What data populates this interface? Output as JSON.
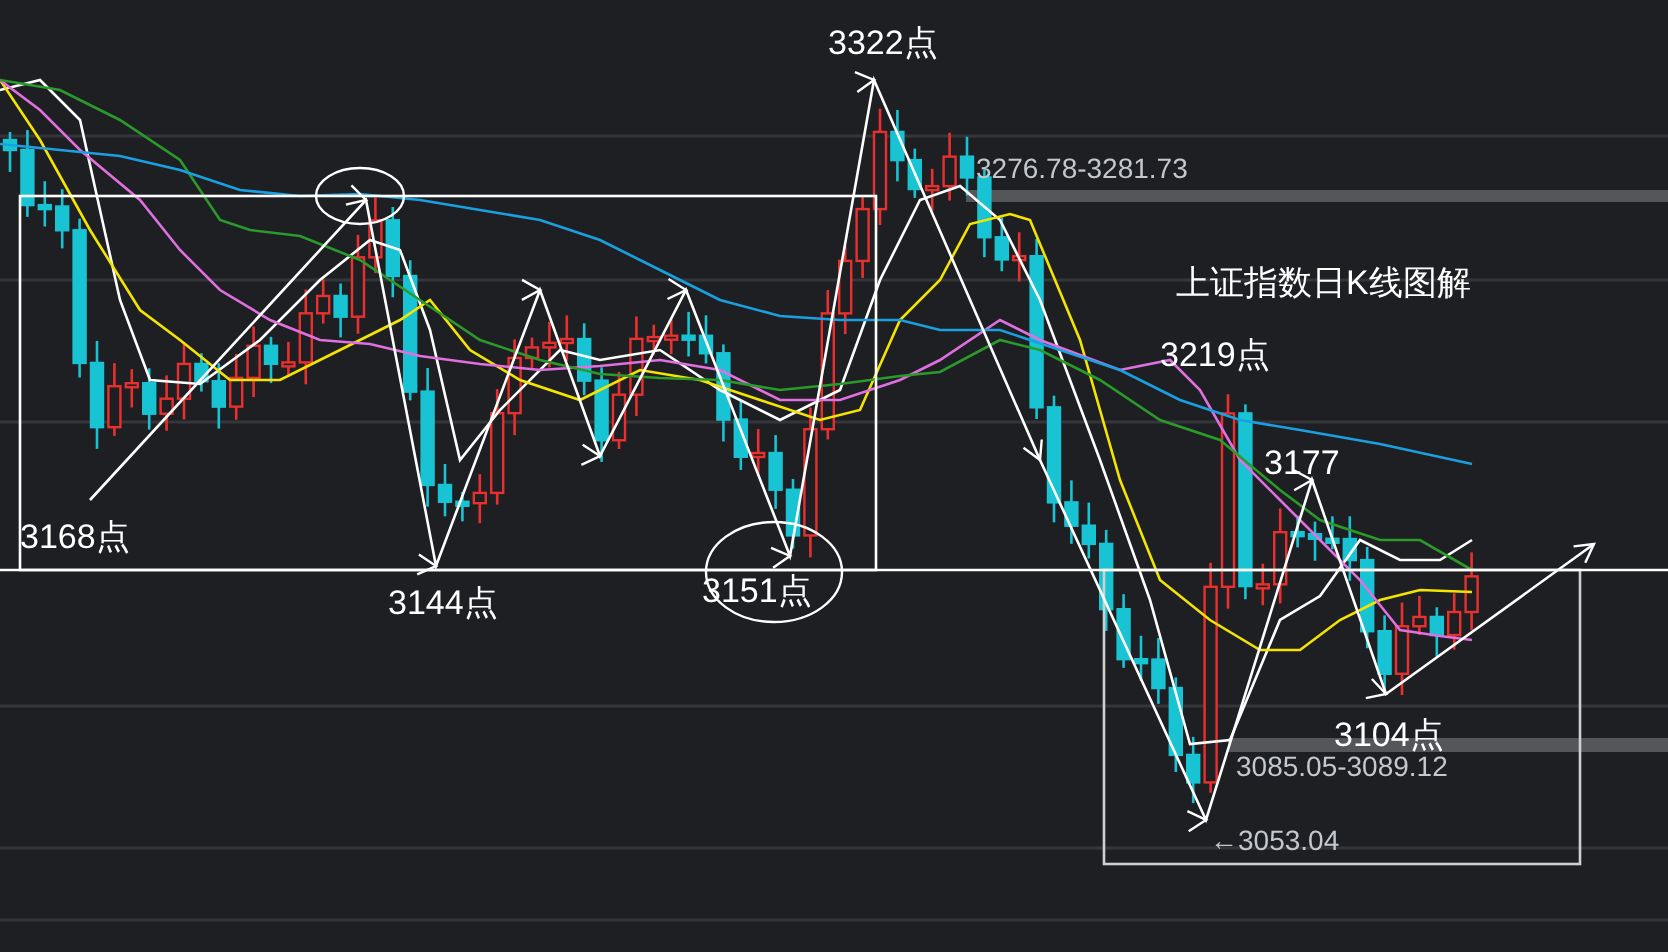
{
  "chart": {
    "title": "上证指数日K线图解",
    "labels": [
      {
        "kind": "point",
        "text": "3322点"
      },
      {
        "kind": "price",
        "text": "3276.78-3281.73"
      },
      {
        "kind": "point",
        "text": "3219点"
      },
      {
        "kind": "point",
        "text": "3177"
      },
      {
        "kind": "point",
        "text": "3168点"
      },
      {
        "kind": "point",
        "text": "3144点"
      },
      {
        "kind": "point",
        "text": "3151点"
      },
      {
        "kind": "point",
        "text": "3104点"
      },
      {
        "kind": "price",
        "text": "3085.05-3089.12"
      },
      {
        "kind": "price",
        "text": "←3053.04"
      }
    ]
  }
}
